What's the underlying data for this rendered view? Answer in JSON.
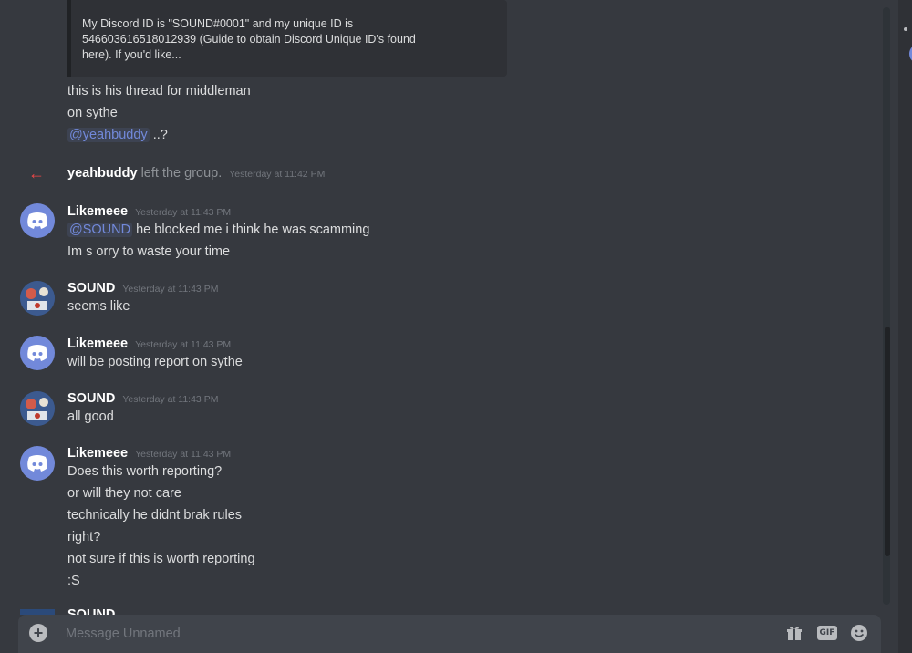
{
  "embed": {
    "text_lines": [
      "My Discord ID is \"SOUND#0001\" and my unique ID is",
      "546603616518012939 (Guide to obtain Discord Unique ID's found",
      "here). If you'd like..."
    ]
  },
  "messages": {
    "m0": {
      "lines": [
        "this is his thread for middleman",
        "on sythe"
      ],
      "mention": "@yeahbuddy",
      "mention_suffix": " ..?"
    },
    "system": {
      "user": "yeahbuddy",
      "action": " left the group.",
      "timestamp": "Yesterday at 11:42 PM"
    },
    "m1": {
      "author": "Likemeee",
      "timestamp": "Yesterday at 11:43 PM",
      "mention": "@SOUND",
      "mention_suffix": " he blocked me i  think he was scamming",
      "line2": "Im s orry to waste your time"
    },
    "m2": {
      "author": "SOUND",
      "timestamp": "Yesterday at 11:43 PM",
      "line1": "seems like"
    },
    "m3": {
      "author": "Likemeee",
      "timestamp": "Yesterday at 11:43 PM",
      "line1": "will be posting report on sythe"
    },
    "m4": {
      "author": "SOUND",
      "timestamp": "Yesterday at 11:43 PM",
      "line1": "all good"
    },
    "m5": {
      "author": "Likemeee",
      "timestamp": "Yesterday at 11:43 PM",
      "lines": [
        "Does this worth reporting?",
        "or will they not care",
        "technically he didnt brak rules",
        "right?",
        "not sure if this is worth reporting",
        ":S"
      ]
    },
    "m6": {
      "author_partial": "SOUND"
    }
  },
  "composer": {
    "placeholder": "Message Unnamed",
    "gif_label": "GIF"
  },
  "icons": [
    "discord-logo-icon",
    "leave-arrow-icon",
    "plus-icon",
    "gift-icon",
    "gif-icon",
    "emoji-icon"
  ],
  "colors": {
    "background": "#36393f",
    "mention": "#7289da",
    "leave": "#f04747",
    "composer": "#40444b"
  }
}
